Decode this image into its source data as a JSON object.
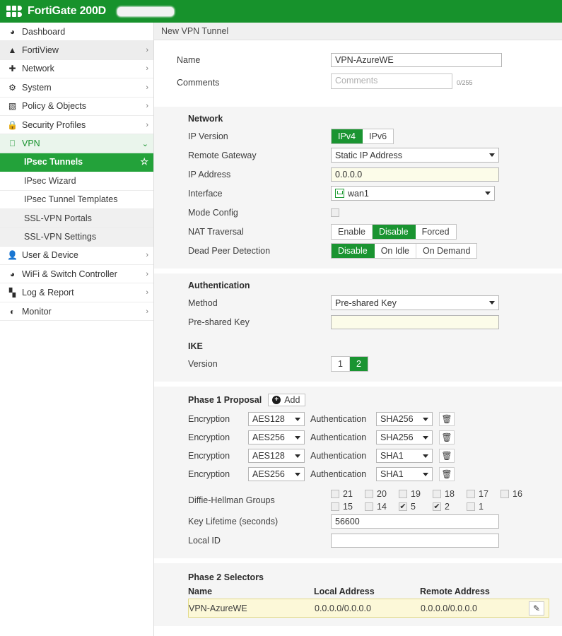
{
  "topbar": {
    "product": "FortiGate 200D",
    "logo_icon": "fortinet-logo-icon",
    "redaction_label": ""
  },
  "sidebar": {
    "items": [
      {
        "label": "Dashboard",
        "icon": "dashboard-icon",
        "chevron": "",
        "expandable": false
      },
      {
        "label": "FortiView",
        "icon": "fortiview-icon",
        "chevron": "›",
        "expandable": true
      },
      {
        "label": "Network",
        "icon": "network-icon",
        "chevron": "›",
        "expandable": true
      },
      {
        "label": "System",
        "icon": "gear-icon",
        "chevron": "›",
        "expandable": true
      },
      {
        "label": "Policy & Objects",
        "icon": "policy-icon",
        "chevron": "›",
        "expandable": true
      },
      {
        "label": "Security Profiles",
        "icon": "lock-icon",
        "chevron": "›",
        "expandable": true
      },
      {
        "label": "VPN",
        "icon": "monitor-icon",
        "chevron": "⌄",
        "expandable": true
      }
    ],
    "vpn_children": [
      {
        "label": "IPsec Tunnels",
        "active": true,
        "star": "☆"
      },
      {
        "label": "IPsec Wizard",
        "active": false,
        "star": ""
      },
      {
        "label": "IPsec Tunnel Templates",
        "active": false,
        "star": ""
      },
      {
        "label": "SSL-VPN Portals",
        "active": false,
        "star": ""
      },
      {
        "label": "SSL-VPN Settings",
        "active": false,
        "star": ""
      }
    ],
    "items_after": [
      {
        "label": "User & Device",
        "icon": "user-icon",
        "chevron": "›"
      },
      {
        "label": "WiFi & Switch Controller",
        "icon": "wifi-icon",
        "chevron": "›"
      },
      {
        "label": "Log & Report",
        "icon": "chart-bars-icon",
        "chevron": "›"
      },
      {
        "label": "Monitor",
        "icon": "pie-chart-icon",
        "chevron": "›"
      }
    ]
  },
  "content": {
    "header_title": "New VPN Tunnel",
    "basic": {
      "name_label": "Name",
      "name_value": "VPN-AzureWE",
      "comments_label": "Comments",
      "comments_value": "",
      "comments_placeholder": "Comments",
      "comments_counter": "0/255"
    },
    "network": {
      "section_title": "Network",
      "ip_version_label": "IP Version",
      "ip_version_options": [
        "IPv4",
        "IPv6"
      ],
      "ip_version_selected": "IPv4",
      "remote_gateway_label": "Remote Gateway",
      "remote_gateway_value": "Static IP Address",
      "ip_address_label": "IP Address",
      "ip_address_value": "0.0.0.0",
      "interface_label": "Interface",
      "interface_value": "wan1",
      "interface_icon": "network-port-icon",
      "mode_config_label": "Mode Config",
      "mode_config_checked": false,
      "nat_traversal_label": "NAT Traversal",
      "nat_traversal_options": [
        "Enable",
        "Disable",
        "Forced"
      ],
      "nat_traversal_selected": "Disable",
      "dpd_label": "Dead Peer Detection",
      "dpd_options": [
        "Disable",
        "On Idle",
        "On Demand"
      ],
      "dpd_selected": "Disable"
    },
    "authentication": {
      "section_title": "Authentication",
      "method_label": "Method",
      "method_value": "Pre-shared Key",
      "psk_label": "Pre-shared Key",
      "psk_value": ""
    },
    "ike": {
      "section_title": "IKE",
      "version_label": "Version",
      "version_options": [
        "1",
        "2"
      ],
      "version_selected": "2"
    },
    "phase1": {
      "title": "Phase 1 Proposal",
      "add_label": "Add",
      "add_icon": "plus-circle-icon",
      "encryption_label": "Encryption",
      "authentication_label": "Authentication",
      "delete_icon": "trash-icon",
      "proposals": [
        {
          "encryption": "AES128",
          "authentication": "SHA256"
        },
        {
          "encryption": "AES256",
          "authentication": "SHA256"
        },
        {
          "encryption": "AES128",
          "authentication": "SHA1"
        },
        {
          "encryption": "AES256",
          "authentication": "SHA1"
        }
      ],
      "dh_label": "Diffie-Hellman Groups",
      "dh_row1": [
        {
          "num": "21",
          "checked": false
        },
        {
          "num": "20",
          "checked": false
        },
        {
          "num": "19",
          "checked": false
        },
        {
          "num": "18",
          "checked": false
        },
        {
          "num": "17",
          "checked": false
        },
        {
          "num": "16",
          "checked": false
        }
      ],
      "dh_row2": [
        {
          "num": "15",
          "checked": false
        },
        {
          "num": "14",
          "checked": false
        },
        {
          "num": "5",
          "checked": true
        },
        {
          "num": "2",
          "checked": true
        },
        {
          "num": "1",
          "checked": false
        }
      ],
      "key_lifetime_label": "Key Lifetime (seconds)",
      "key_lifetime_value": "56600",
      "local_id_label": "Local ID",
      "local_id_value": ""
    },
    "phase2": {
      "title": "Phase 2 Selectors",
      "columns": [
        "Name",
        "Local Address",
        "Remote Address"
      ],
      "edit_icon": "pencil-icon",
      "rows": [
        {
          "name": "VPN-AzureWE",
          "local": "0.0.0.0/0.0.0.0",
          "remote": "0.0.0.0/0.0.0.0"
        }
      ]
    }
  },
  "colors": {
    "brand_green": "#17922c",
    "active_green": "#23a23a",
    "toggle_green": "#1a9431",
    "cream_field": "#fcfce9",
    "highlight_row": "#fcf8d8"
  }
}
